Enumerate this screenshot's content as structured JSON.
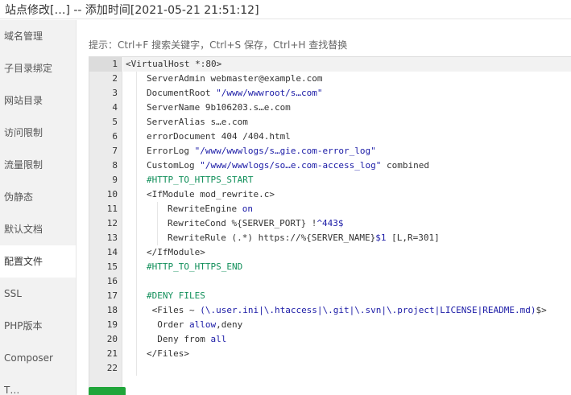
{
  "header": {
    "title": "站点修改[…] -- 添加时间[2021-05-21 21:51:12]"
  },
  "sidebar": {
    "items": [
      {
        "label": "域名管理"
      },
      {
        "label": "子目录绑定"
      },
      {
        "label": "网站目录"
      },
      {
        "label": "访问限制"
      },
      {
        "label": "流量限制"
      },
      {
        "label": "伪静态"
      },
      {
        "label": "默认文档"
      },
      {
        "label": "配置文件",
        "active": true
      },
      {
        "label": "SSL"
      },
      {
        "label": "PHP版本"
      },
      {
        "label": "Composer"
      },
      {
        "label": "T…"
      }
    ]
  },
  "hint": "提示：Ctrl+F 搜索关键字，Ctrl+S 保存，Ctrl+H 查找替换",
  "editor": {
    "active_line": 1,
    "lines": [
      {
        "n": "1",
        "i": 0,
        "parts": [
          [
            "t",
            "<VirtualHost *:80>"
          ]
        ]
      },
      {
        "n": "2",
        "i": 1,
        "parts": [
          [
            "t",
            "ServerAdmin webmaster@example.com"
          ]
        ]
      },
      {
        "n": "3",
        "i": 1,
        "parts": [
          [
            "t",
            "DocumentRoot "
          ],
          [
            "s",
            "\"/www/wwwroot/s…com\""
          ]
        ]
      },
      {
        "n": "4",
        "i": 1,
        "parts": [
          [
            "t",
            "ServerName 9b106203.s…e.com"
          ]
        ]
      },
      {
        "n": "5",
        "i": 1,
        "parts": [
          [
            "t",
            "ServerAlias s…e.com"
          ]
        ]
      },
      {
        "n": "6",
        "i": 1,
        "parts": [
          [
            "t",
            "errorDocument 404 /404.html"
          ]
        ]
      },
      {
        "n": "7",
        "i": 1,
        "parts": [
          [
            "t",
            "ErrorLog "
          ],
          [
            "s",
            "\"/www/wwwlogs/s…gie.com-error_log\""
          ]
        ]
      },
      {
        "n": "8",
        "i": 1,
        "parts": [
          [
            "t",
            "CustomLog "
          ],
          [
            "s",
            "\"/www/wwwlogs/so…e.com-access_log\""
          ],
          [
            "t",
            " combined"
          ]
        ]
      },
      {
        "n": "9",
        "i": 1,
        "parts": [
          [
            "c",
            "#HTTP_TO_HTTPS_START"
          ]
        ]
      },
      {
        "n": "10",
        "i": 1,
        "parts": [
          [
            "t",
            "<IfModule mod_rewrite.c>"
          ]
        ]
      },
      {
        "n": "11",
        "i": 2,
        "parts": [
          [
            "t",
            "RewriteEngine "
          ],
          [
            "k",
            "on"
          ]
        ]
      },
      {
        "n": "12",
        "i": 2,
        "parts": [
          [
            "t",
            "RewriteCond %{SERVER_PORT} !"
          ],
          [
            "k",
            "^443$"
          ]
        ]
      },
      {
        "n": "13",
        "i": 2,
        "parts": [
          [
            "t",
            "RewriteRule (.*) https://%{SERVER_NAME}"
          ],
          [
            "k",
            "$1"
          ],
          [
            "t",
            " [L,R=301]"
          ]
        ]
      },
      {
        "n": "14",
        "i": 1,
        "parts": [
          [
            "t",
            "</IfModule>"
          ]
        ]
      },
      {
        "n": "15",
        "i": 1,
        "parts": [
          [
            "c",
            "#HTTP_TO_HTTPS_END"
          ]
        ]
      },
      {
        "n": "16",
        "i": 1,
        "parts": [
          [
            "t",
            ""
          ]
        ]
      },
      {
        "n": "17",
        "i": 1,
        "parts": [
          [
            "c",
            "#DENY FILES"
          ]
        ]
      },
      {
        "n": "18",
        "i": 1,
        "parts": [
          [
            "t",
            " <Files ~ "
          ],
          [
            "s",
            "(\\.user.ini|\\.htaccess|\\.git|\\.svn|\\.project|LICENSE|README.md)"
          ],
          [
            "t",
            "$>"
          ]
        ]
      },
      {
        "n": "19",
        "i": 1,
        "parts": [
          [
            "t",
            "  Order "
          ],
          [
            "k",
            "allow"
          ],
          [
            "t",
            ",deny"
          ]
        ]
      },
      {
        "n": "20",
        "i": 1,
        "parts": [
          [
            "t",
            "  Deny from "
          ],
          [
            "k",
            "all"
          ]
        ]
      },
      {
        "n": "21",
        "i": 1,
        "parts": [
          [
            "t",
            "</Files>"
          ]
        ]
      },
      {
        "n": "22",
        "i": 1,
        "parts": [
          [
            "t",
            ""
          ]
        ]
      }
    ]
  },
  "colors": {
    "save_button": "#20a53a",
    "string": "#1a1aa6",
    "comment": "#118f5a"
  }
}
